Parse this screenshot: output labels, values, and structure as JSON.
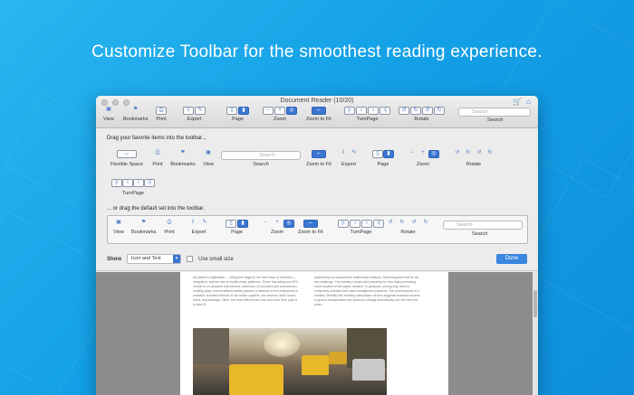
{
  "headline": "Customize Toolbar for the smoothest reading experience.",
  "window": {
    "title": "Document Reader (10/20)",
    "toolbar": {
      "view": "View",
      "bookmarks": "Bookmarks",
      "print": "Print",
      "export": "Export",
      "page": "Page",
      "zoom": "Zoom",
      "zoom_to_fit": "Zoom to Fit",
      "turnpage": "TurnPage",
      "rotate": "Rotate",
      "search": "Search",
      "search_placeholder": "Search"
    }
  },
  "sheet": {
    "drag_favorites": "Drag your favorite items into the toolbar...",
    "drag_default": "... or drag the default set into the toolbar.",
    "items": {
      "flexible_space": "Flexible Space",
      "print": "Print",
      "bookmarks": "Bookmarks",
      "view": "View",
      "search": "Search",
      "zoom_to_fit": "Zoom to Fit",
      "export": "Export",
      "page": "Page",
      "zoom": "Zoom",
      "rotate": "Rotate",
      "turnpage": "TurnPage",
      "search_placeholder": "Search"
    },
    "default_set": {
      "view": "View",
      "bookmarks": "Bookmarks",
      "print": "Print",
      "export": "Export",
      "page": "Page",
      "zoom": "Zoom",
      "zoom_to_fit": "Zoom to Fit",
      "turnpage": "TurnPage",
      "rotate": "Rotate",
      "search": "Search",
      "search_placeholder": "Search"
    },
    "show_label": "Show",
    "show_value": "Icon and Text",
    "small_size_label": "Use small size",
    "done": "Done"
  },
  "document": {
    "col_left": "the public to digitization — hitting the stage for the next wave of evolution — integration, and the rise of mobile-ready platforms. Those risk-taking and ROI remain to un-derstand that became observers, of recorders and autonomous mobility plays, each enabled mobility sparked a network of new enterprises in crowded, crowded network of car rental suppliers, car services, taxis, buses, trains, and subways. Often, the most efficient and low-cost route from point A to point B",
    "col_right": "partnerships to expand their multimodal solutions. Data integration will be the key challenge. The industry should start preparing for new data processing more required of the higher demand. In particular, storing may need to completely overhaul their data management practices. The recent launch of a monthly 'Mobility-first' booking subscription service suggests business models in ground transportation are poised to change dramatically over the next five years."
  },
  "colors": {
    "accent": "#3a76d2",
    "background": "#13a0e6"
  }
}
